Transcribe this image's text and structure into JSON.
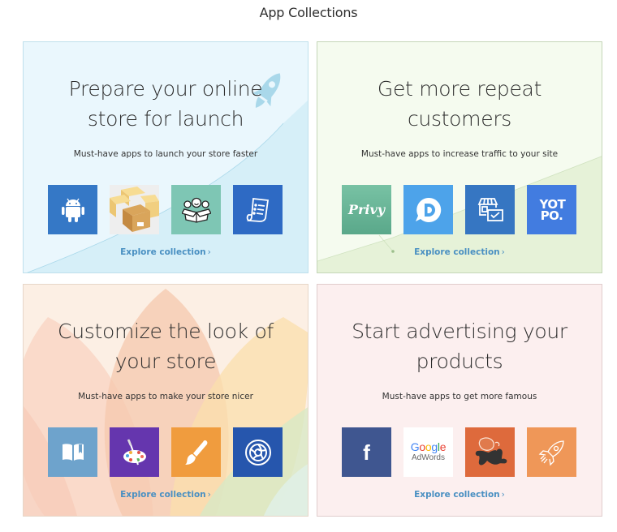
{
  "page": {
    "title": "App Collections"
  },
  "collections": [
    {
      "title": "Prepare your online store for launch",
      "subtitle": "Must-have apps to launch your store faster",
      "link": "Explore collection",
      "link_chevron": "›",
      "background_color": "#eaf7fd",
      "decoration": "rocket-icon",
      "apps": [
        {
          "icon": "android-icon",
          "color": "#3578c6"
        },
        {
          "icon": "boxes-icon",
          "color": "#eeeeee"
        },
        {
          "icon": "smiling-box-icon",
          "color": "#7ec6b4"
        },
        {
          "icon": "invoice-list-icon",
          "color": "#2e6ac4"
        }
      ]
    },
    {
      "title": "Get more repeat customers",
      "subtitle": "Must-have apps to increase traffic to your site",
      "link": "Explore collection",
      "link_chevron": "›",
      "background_color": "#f5fbef",
      "apps": [
        {
          "icon": "privy-logo",
          "label": "Privy",
          "color": "#6dbb9c"
        },
        {
          "icon": "disqus-logo",
          "label": "D",
          "color": "#4da3ea"
        },
        {
          "icon": "storefront-mail-icon",
          "color": "#3676c2"
        },
        {
          "icon": "yotpo-logo",
          "label": "YOT PO.",
          "color": "#427ce0"
        }
      ]
    },
    {
      "title": "Customize the look of your store",
      "subtitle": "Must-have apps to make your store nicer",
      "link": "Explore collection",
      "link_chevron": "›",
      "background_color": "#fcefe4",
      "apps": [
        {
          "icon": "book-icon",
          "color": "#6ea3cc"
        },
        {
          "icon": "paint-palette-icon",
          "color": "#6536ae"
        },
        {
          "icon": "paintbrush-icon",
          "color": "#f09c3e"
        },
        {
          "icon": "camera-aperture-icon",
          "color": "#2656ad"
        }
      ]
    },
    {
      "title": "Start advertising your products",
      "subtitle": "Must-have apps to get more famous",
      "link": "Explore collection",
      "link_chevron": "›",
      "background_color": "#fcefef",
      "apps": [
        {
          "icon": "facebook-logo",
          "label": "f",
          "color": "#3f5690"
        },
        {
          "icon": "google-adwords-logo",
          "label_top": "Google",
          "label_bottom": "AdWords",
          "color": "#ffffff"
        },
        {
          "icon": "octopus-icon",
          "color": "#de6a3c"
        },
        {
          "icon": "rocket-outline-icon",
          "color": "#ef9758"
        }
      ]
    }
  ]
}
